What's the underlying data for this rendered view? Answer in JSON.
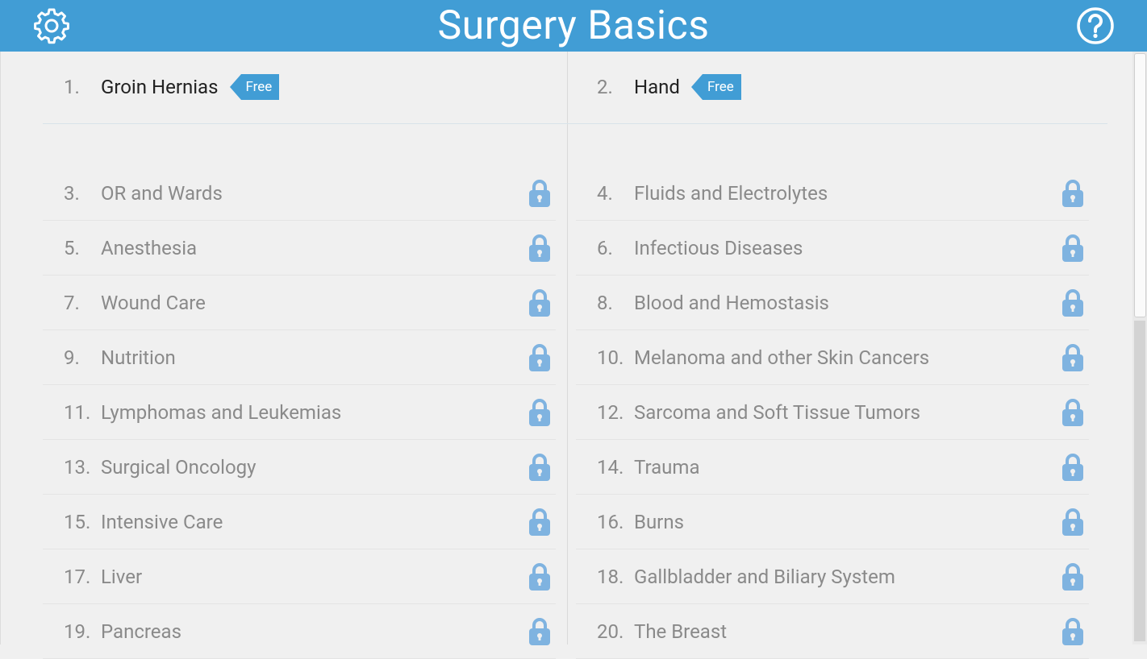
{
  "header": {
    "title": "Surgery Basics",
    "settings_icon": "gear-icon",
    "help_icon": "help-icon"
  },
  "free_items": [
    {
      "num": "1.",
      "label": "Groin Hernias",
      "badge": "Free"
    },
    {
      "num": "2.",
      "label": "Hand",
      "badge": "Free"
    }
  ],
  "left_items": [
    {
      "num": "3.",
      "label": "OR and Wards"
    },
    {
      "num": "5.",
      "label": "Anesthesia"
    },
    {
      "num": "7.",
      "label": "Wound Care"
    },
    {
      "num": "9.",
      "label": "Nutrition"
    },
    {
      "num": "11.",
      "label": "Lymphomas and Leukemias"
    },
    {
      "num": "13.",
      "label": "Surgical Oncology"
    },
    {
      "num": "15.",
      "label": "Intensive Care"
    },
    {
      "num": "17.",
      "label": "Liver"
    },
    {
      "num": "19.",
      "label": "Pancreas"
    }
  ],
  "right_items": [
    {
      "num": "4.",
      "label": "Fluids and Electrolytes"
    },
    {
      "num": "6.",
      "label": "Infectious Diseases"
    },
    {
      "num": "8.",
      "label": "Blood and Hemostasis"
    },
    {
      "num": "10.",
      "label": "Melanoma and other Skin Cancers"
    },
    {
      "num": "12.",
      "label": "Sarcoma and Soft Tissue Tumors"
    },
    {
      "num": "14.",
      "label": "Trauma"
    },
    {
      "num": "16.",
      "label": "Burns"
    },
    {
      "num": "18.",
      "label": "Gallbladder and Biliary System"
    },
    {
      "num": "20.",
      "label": "The Breast"
    }
  ],
  "lock_icon": "lock-icon",
  "colors": {
    "header": "#419dd5",
    "badge": "#419dd5",
    "lock": "#7fb3e0"
  }
}
